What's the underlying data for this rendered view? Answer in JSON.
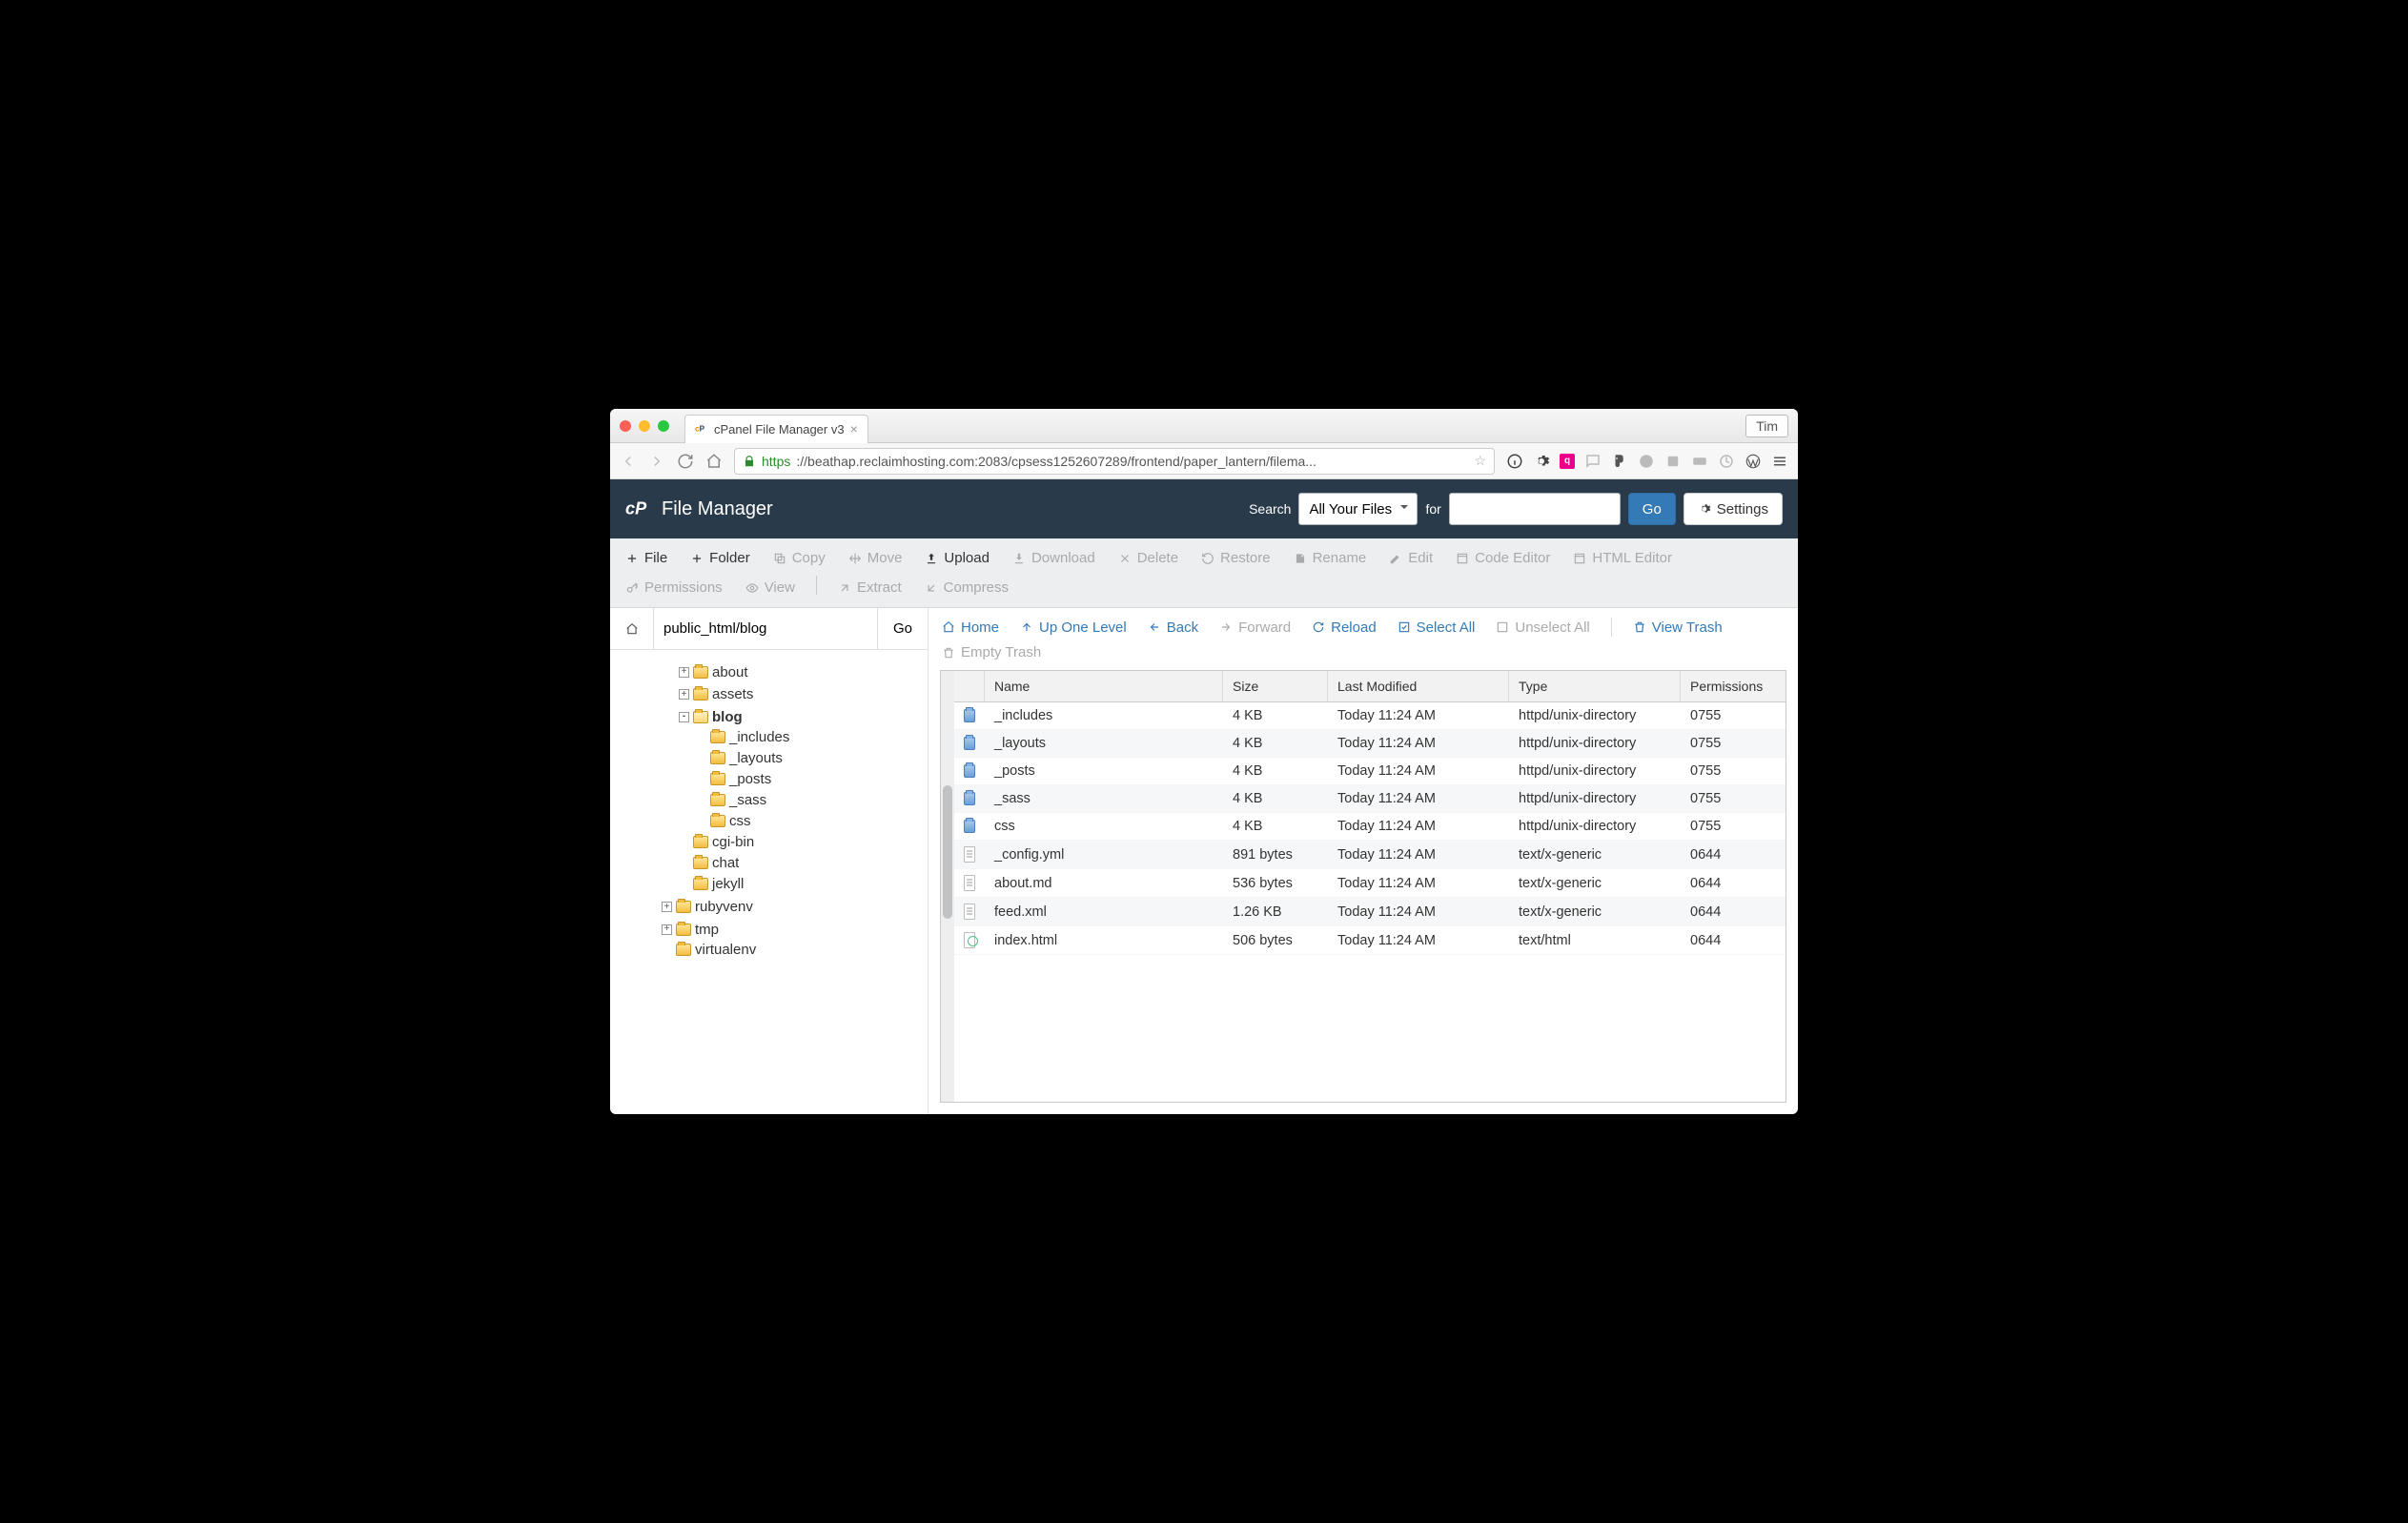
{
  "browser": {
    "tab_title": "cPanel File Manager v3",
    "user_button": "Tim",
    "url_scheme": "https",
    "url_rest": "://beathap.reclaimhosting.com:2083/cpsess1252607289/frontend/paper_lantern/filema..."
  },
  "header": {
    "app_title": "File Manager",
    "search_label": "Search",
    "search_scope": "All Your Files",
    "for_label": "for",
    "search_value": "",
    "go_label": "Go",
    "settings_label": "Settings"
  },
  "toolbar": {
    "file": "File",
    "folder": "Folder",
    "copy": "Copy",
    "move": "Move",
    "upload": "Upload",
    "download": "Download",
    "delete": "Delete",
    "restore": "Restore",
    "rename": "Rename",
    "edit": "Edit",
    "code_editor": "Code Editor",
    "html_editor": "HTML Editor",
    "permissions": "Permissions",
    "view": "View",
    "extract": "Extract",
    "compress": "Compress"
  },
  "path": {
    "value": "public_html/blog",
    "go": "Go"
  },
  "tree": [
    {
      "label": "about",
      "depth": 1,
      "exp": "+"
    },
    {
      "label": "assets",
      "depth": 1,
      "exp": "+"
    },
    {
      "label": "blog",
      "depth": 1,
      "exp": "-",
      "bold": true,
      "open": true
    },
    {
      "label": "_includes",
      "depth": 2,
      "exp": ""
    },
    {
      "label": "_layouts",
      "depth": 2,
      "exp": ""
    },
    {
      "label": "_posts",
      "depth": 2,
      "exp": ""
    },
    {
      "label": "_sass",
      "depth": 2,
      "exp": ""
    },
    {
      "label": "css",
      "depth": 2,
      "exp": ""
    },
    {
      "label": "cgi-bin",
      "depth": 1,
      "exp": ""
    },
    {
      "label": "chat",
      "depth": 1,
      "exp": ""
    },
    {
      "label": "jekyll",
      "depth": 1,
      "exp": ""
    },
    {
      "label": "rubyvenv",
      "depth": 0,
      "exp": "+"
    },
    {
      "label": "tmp",
      "depth": 0,
      "exp": "+"
    },
    {
      "label": "virtualenv",
      "depth": 0,
      "exp": ""
    }
  ],
  "actions": {
    "home": "Home",
    "up": "Up One Level",
    "back": "Back",
    "forward": "Forward",
    "reload": "Reload",
    "select_all": "Select All",
    "unselect_all": "Unselect All",
    "view_trash": "View Trash",
    "empty_trash": "Empty Trash"
  },
  "grid": {
    "headers": {
      "name": "Name",
      "size": "Size",
      "modified": "Last Modified",
      "type": "Type",
      "perm": "Permissions"
    },
    "rows": [
      {
        "kind": "dir",
        "name": "_includes",
        "size": "4 KB",
        "mod": "Today 11:24 AM",
        "type": "httpd/unix-directory",
        "perm": "0755"
      },
      {
        "kind": "dir",
        "name": "_layouts",
        "size": "4 KB",
        "mod": "Today 11:24 AM",
        "type": "httpd/unix-directory",
        "perm": "0755"
      },
      {
        "kind": "dir",
        "name": "_posts",
        "size": "4 KB",
        "mod": "Today 11:24 AM",
        "type": "httpd/unix-directory",
        "perm": "0755"
      },
      {
        "kind": "dir",
        "name": "_sass",
        "size": "4 KB",
        "mod": "Today 11:24 AM",
        "type": "httpd/unix-directory",
        "perm": "0755"
      },
      {
        "kind": "dir",
        "name": "css",
        "size": "4 KB",
        "mod": "Today 11:24 AM",
        "type": "httpd/unix-directory",
        "perm": "0755"
      },
      {
        "kind": "file",
        "name": "_config.yml",
        "size": "891 bytes",
        "mod": "Today 11:24 AM",
        "type": "text/x-generic",
        "perm": "0644"
      },
      {
        "kind": "file",
        "name": "about.md",
        "size": "536 bytes",
        "mod": "Today 11:24 AM",
        "type": "text/x-generic",
        "perm": "0644"
      },
      {
        "kind": "file",
        "name": "feed.xml",
        "size": "1.26 KB",
        "mod": "Today 11:24 AM",
        "type": "text/x-generic",
        "perm": "0644"
      },
      {
        "kind": "html",
        "name": "index.html",
        "size": "506 bytes",
        "mod": "Today 11:24 AM",
        "type": "text/html",
        "perm": "0644"
      }
    ]
  }
}
